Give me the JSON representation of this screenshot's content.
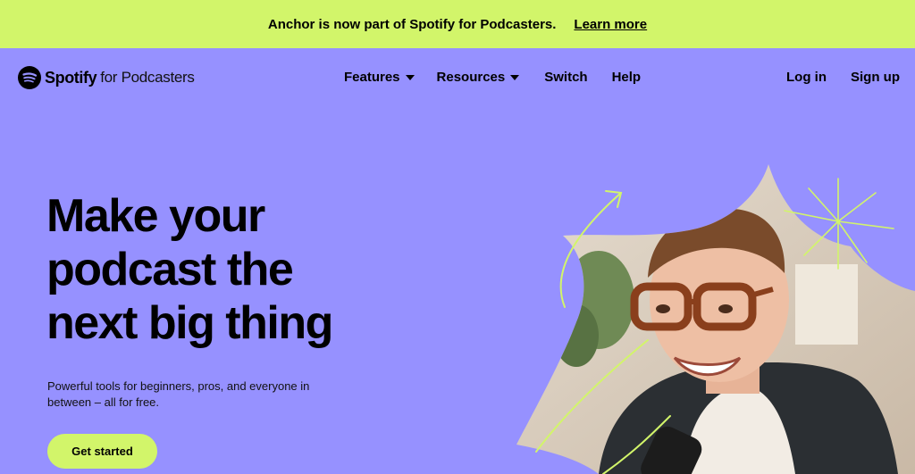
{
  "banner": {
    "text": "Anchor is now part of Spotify for Podcasters.",
    "link": "Learn more"
  },
  "logo": {
    "brand": "Spotify",
    "suffix": "for Podcasters"
  },
  "nav": {
    "items": [
      {
        "label": "Features",
        "dropdown": true
      },
      {
        "label": "Resources",
        "dropdown": true
      },
      {
        "label": "Switch",
        "dropdown": false
      },
      {
        "label": "Help",
        "dropdown": false
      }
    ],
    "login": "Log in",
    "signup": "Sign up"
  },
  "hero": {
    "title_lines": [
      "Make your",
      "podcast the",
      "next big thing"
    ],
    "subtitle": "Powerful tools for beginners, pros, and everyone in between – all for free.",
    "cta": "Get started"
  },
  "colors": {
    "banner_bg": "#d2f56a",
    "page_bg": "#9691ff",
    "accent": "#d2f56a",
    "text": "#000000"
  },
  "icons": [
    "spotify-logo-icon",
    "caret-down-icon"
  ]
}
